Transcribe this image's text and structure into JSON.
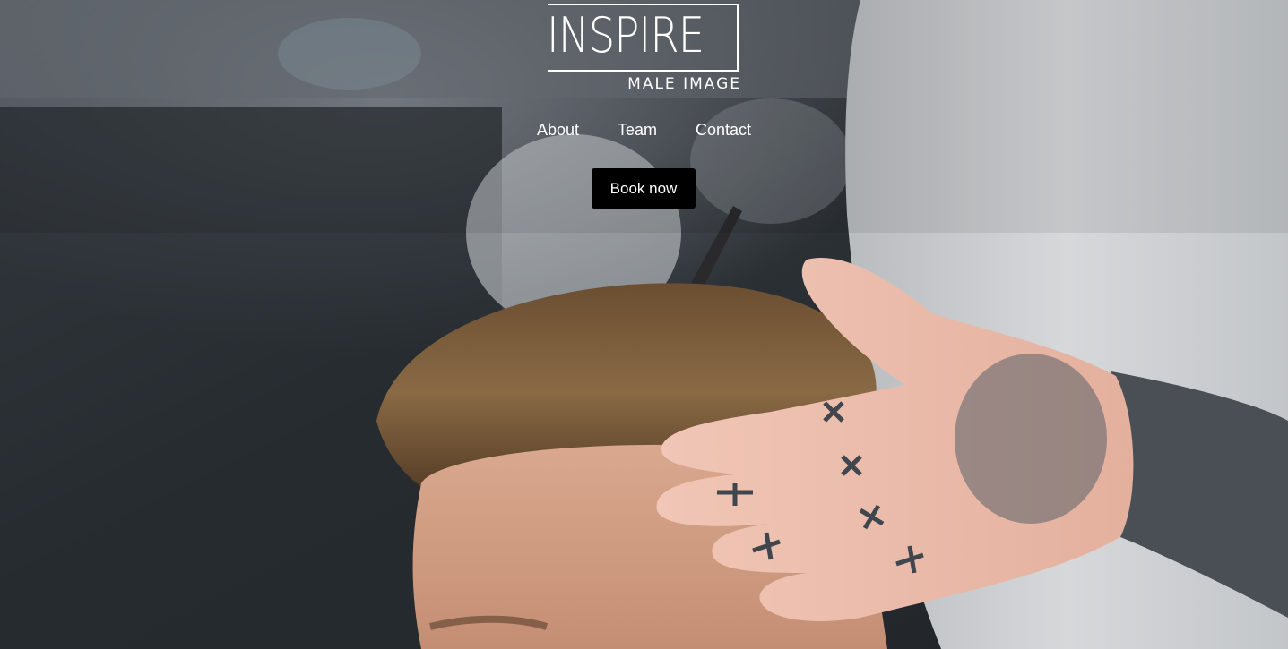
{
  "logo": {
    "title": "INSPIRE",
    "subtitle": "MALE IMAGE"
  },
  "nav": {
    "items": [
      {
        "label": "About"
      },
      {
        "label": "Team"
      },
      {
        "label": "Contact"
      }
    ]
  },
  "cta": {
    "label": "Book now"
  },
  "colors": {
    "text": "#ffffff",
    "button_bg": "#000000"
  }
}
